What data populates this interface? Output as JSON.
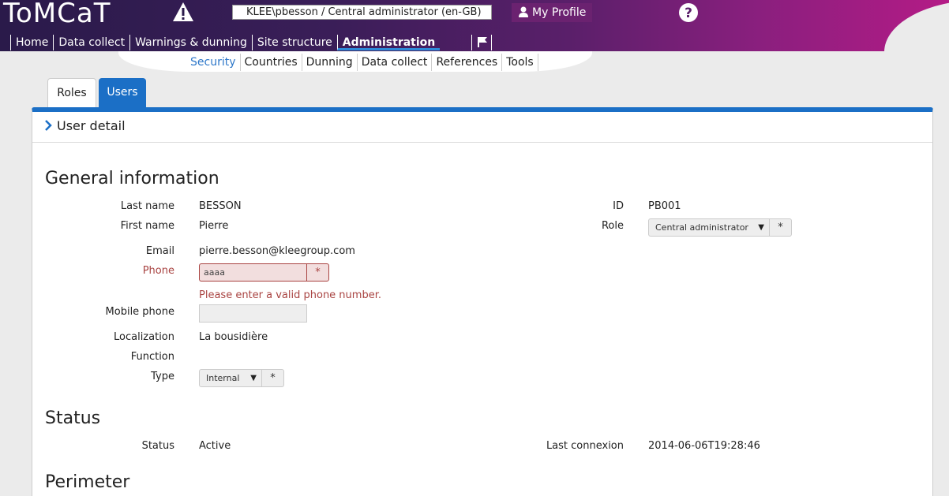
{
  "app": {
    "logo": "ToMCaT"
  },
  "header": {
    "user_context": "KLEE\\pbesson / Central administrator (en-GB)",
    "profile_label": "My Profile",
    "warning_icon": "warning-icon",
    "help_icon": "help-icon"
  },
  "main_nav": {
    "items": [
      {
        "label": "Home"
      },
      {
        "label": "Data collect"
      },
      {
        "label": "Warnings & dunning"
      },
      {
        "label": "Site structure"
      },
      {
        "label": "Administration",
        "active": true
      }
    ],
    "flag_icon": "flag-icon"
  },
  "sub_nav": {
    "items": [
      {
        "label": "Security",
        "active": true
      },
      {
        "label": "Countries"
      },
      {
        "label": "Dunning"
      },
      {
        "label": "Data collect"
      },
      {
        "label": "References"
      },
      {
        "label": "Tools"
      }
    ]
  },
  "tabs": [
    {
      "label": "Roles"
    },
    {
      "label": "Users",
      "active": true
    }
  ],
  "panel": {
    "title": "User detail"
  },
  "general": {
    "title": "General information",
    "last_name_label": "Last name",
    "last_name": "BESSON",
    "first_name_label": "First name",
    "first_name": "Pierre",
    "email_label": "Email",
    "email": "pierre.besson@kleegroup.com",
    "phone_label": "Phone",
    "phone_value": "aaaa",
    "phone_required": "*",
    "phone_error": "Please enter a valid phone number.",
    "mobile_label": "Mobile phone",
    "mobile_value": "",
    "localization_label": "Localization",
    "localization": "La bousidière",
    "function_label": "Function",
    "function": "",
    "type_label": "Type",
    "type_value": "Internal",
    "type_required": "*",
    "id_label": "ID",
    "id": "PB001",
    "role_label": "Role",
    "role_value": "Central administrator",
    "role_required": "*"
  },
  "status": {
    "title": "Status",
    "status_label": "Status",
    "status": "Active",
    "last_connexion_label": "Last connexion",
    "last_connexion": "2014-06-06T19:28:46"
  },
  "perimeter": {
    "title": "Perimeter"
  },
  "colors": {
    "primary": "#1b6fc6",
    "error": "#a94442",
    "header_start": "#2a1a4a",
    "header_end": "#b41b86"
  }
}
